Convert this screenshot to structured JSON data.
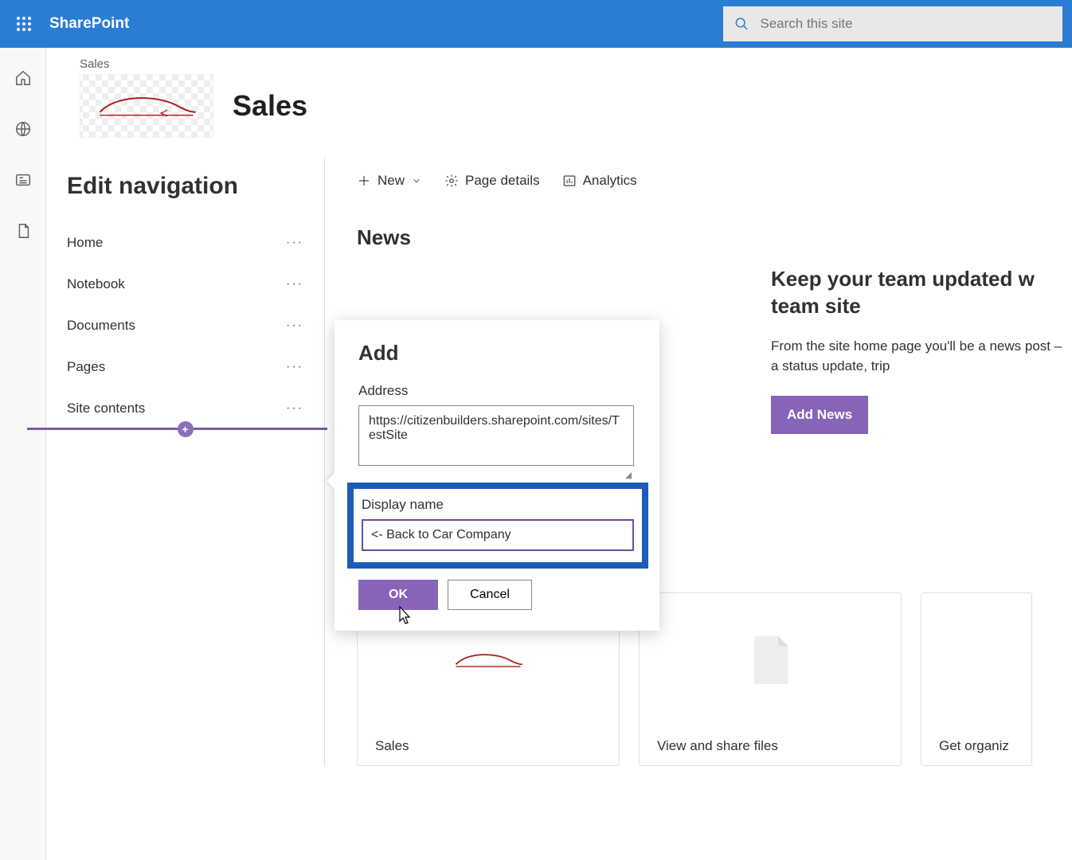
{
  "app_name": "SharePoint",
  "search_placeholder": "Search this site",
  "site": {
    "breadcrumb": "Sales",
    "title": "Sales"
  },
  "nav": {
    "title": "Edit navigation",
    "items": [
      {
        "label": "Home"
      },
      {
        "label": "Notebook"
      },
      {
        "label": "Documents"
      },
      {
        "label": "Pages"
      },
      {
        "label": "Site contents"
      }
    ]
  },
  "cmd": {
    "new": "New",
    "page_details": "Page details",
    "analytics": "Analytics"
  },
  "news": {
    "heading": "News",
    "title": "Keep your team updated w",
    "subtitle": "team site",
    "body": "From the site home page you'll be a news post – a status update, trip ",
    "add_button": "Add News"
  },
  "callout": {
    "title": "Add",
    "address_label": "Address",
    "address_value": "https://citizenbuilders.sharepoint.com/sites/TestSite",
    "display_label": "Display name",
    "display_value": "<- Back to Car Company",
    "ok": "OK",
    "cancel": "Cancel"
  },
  "cards": [
    {
      "label": "Sales"
    },
    {
      "label": "View and share files"
    },
    {
      "label": "Get organiz"
    }
  ]
}
